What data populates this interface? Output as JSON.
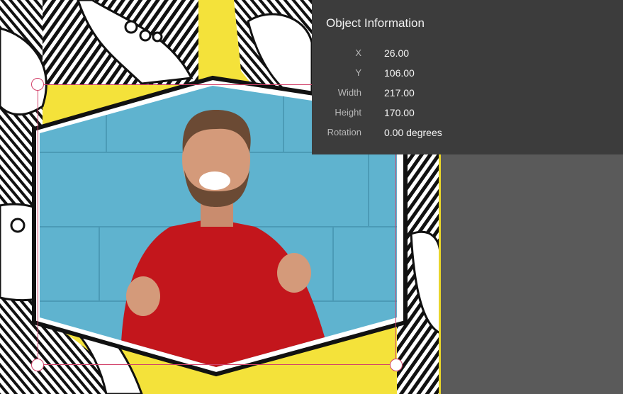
{
  "panel": {
    "title": "Object Information",
    "rows": [
      {
        "label": "X",
        "value": "26.00"
      },
      {
        "label": "Y",
        "value": "106.00"
      },
      {
        "label": "Width",
        "value": "217.00"
      },
      {
        "label": "Height",
        "value": "170.00"
      },
      {
        "label": "Rotation",
        "value": "0.00 degrees"
      }
    ]
  },
  "canvas": {
    "background_color": "#f4e23a",
    "selection_color": "#d2426a",
    "photo_wall_color": "#5fb3cf",
    "shirt_color": "#c3161c"
  }
}
